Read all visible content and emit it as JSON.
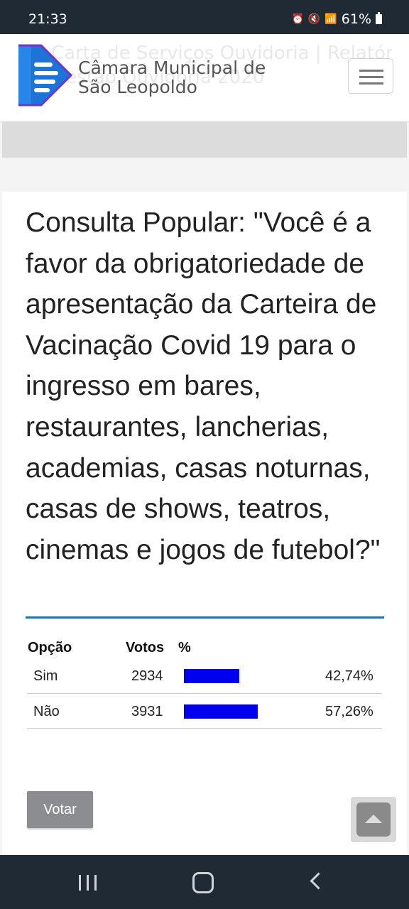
{
  "status_bar": {
    "time": "21:33",
    "battery": "61%"
  },
  "header": {
    "ghost_title_line1": "Carta de Serviços Ouvidoria | Relatório de",
    "ghost_title_line2": "Gestão Ouvidoria 2020",
    "brand_line1": "Câmara Municipal de",
    "brand_line2": "São Leopoldo"
  },
  "poll": {
    "title": "Consulta Popular: \"Você é a favor da obrigatoriedade de apresentação da Carteira de Vacinação Covid 19 para o ingresso em bares, restaurantes, lancherias, academias, casas noturnas, casas de shows, teatros, cinemas e jogos de futebol?\"",
    "columns": {
      "option": "Opção",
      "votes": "Votos",
      "percent": "%"
    },
    "rows": [
      {
        "option": "Sim",
        "votes": "2934",
        "percent_label": "42,74%",
        "fraction": 0.4274
      },
      {
        "option": "Não",
        "votes": "3931",
        "percent_label": "57,26%",
        "fraction": 0.5726
      }
    ],
    "vote_button": "Votar"
  },
  "colors": {
    "bar": "#0000ee",
    "accent_rule": "#2a6ea8",
    "button": "#8c8d91"
  }
}
